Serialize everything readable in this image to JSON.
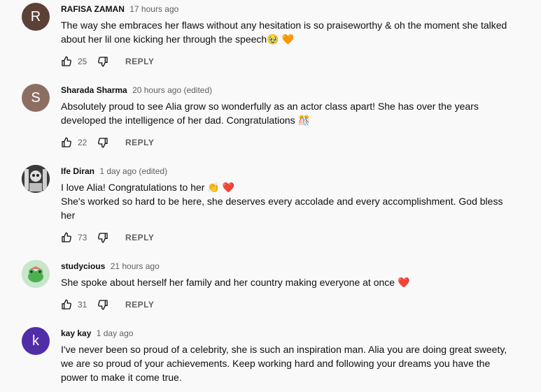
{
  "reply_label": "REPLY",
  "comments": [
    {
      "author": "RAFISA ZAMAN",
      "time": "17 hours ago",
      "avatar_letter": "R",
      "avatar_color": "#5d4037",
      "lines": [
        "The way she embraces her flaws without any hesitation is so praiseworthy & oh the moment she talked about her lil one kicking her through the speech🥹 🧡"
      ],
      "likes": "25"
    },
    {
      "author": "Sharada Sharma",
      "time": "20 hours ago (edited)",
      "avatar_letter": "S",
      "avatar_color": "#8d6e63",
      "lines": [
        "Absolutely proud to see Alia grow so wonderfully as an actor class apart! She has over the years developed the intelligence of her dad. Congratulations 🎊"
      ],
      "likes": "22"
    },
    {
      "author": "Ife Diran",
      "time": "1 day ago (edited)",
      "avatar_letter": "",
      "avatar_color": "#2b2b2b",
      "lines": [
        "I love Alia! Congratulations to her 👏 ❤️",
        "She's worked so hard to be here, she deserves every accolade and every accomplishment. God bless her"
      ],
      "likes": "73"
    },
    {
      "author": "studycious",
      "time": "21 hours ago",
      "avatar_letter": "",
      "avatar_color": "#c8e6c9",
      "lines": [
        "She spoke about herself her family and her country making everyone  at once ❤️"
      ],
      "likes": "31"
    },
    {
      "author": "kay kay",
      "time": "1 day ago",
      "avatar_letter": "k",
      "avatar_color": "#512da8",
      "lines": [
        "I've never been so proud of a celebrity, she is such an inspiration man. Alia you are doing great sweety, we are so proud of your achievements. Keep working hard and following your dreams you have the power to make it come true."
      ],
      "likes": ""
    }
  ]
}
